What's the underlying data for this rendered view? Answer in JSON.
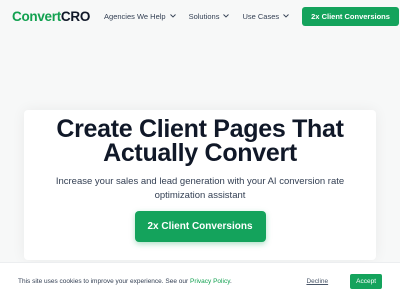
{
  "header": {
    "logo_part1": "Convert",
    "logo_part2": "CRO",
    "nav": [
      {
        "label": "Agencies We Help"
      },
      {
        "label": "Solutions"
      },
      {
        "label": "Use Cases"
      }
    ],
    "cta_label": "2x Client Conversions"
  },
  "hero": {
    "title_line1": "Create Client Pages That",
    "title_line2": "Actually Convert",
    "subtitle": "Increase your sales and lead generation with your AI conversion rate optimization assistant",
    "cta_label": "2x Client Conversions"
  },
  "cookie": {
    "text": "This site uses cookies to improve your experience. See our ",
    "link_label": "Privacy Policy",
    "link_suffix": ".",
    "decline_label": "Decline",
    "accept_label": "Accept"
  },
  "colors": {
    "accent": "#14a35c",
    "logo_green": "#12a150",
    "text_dark": "#101828",
    "background": "#f7f8f8"
  },
  "icons": {
    "nav_dropdown": "chevron-down-icon"
  }
}
